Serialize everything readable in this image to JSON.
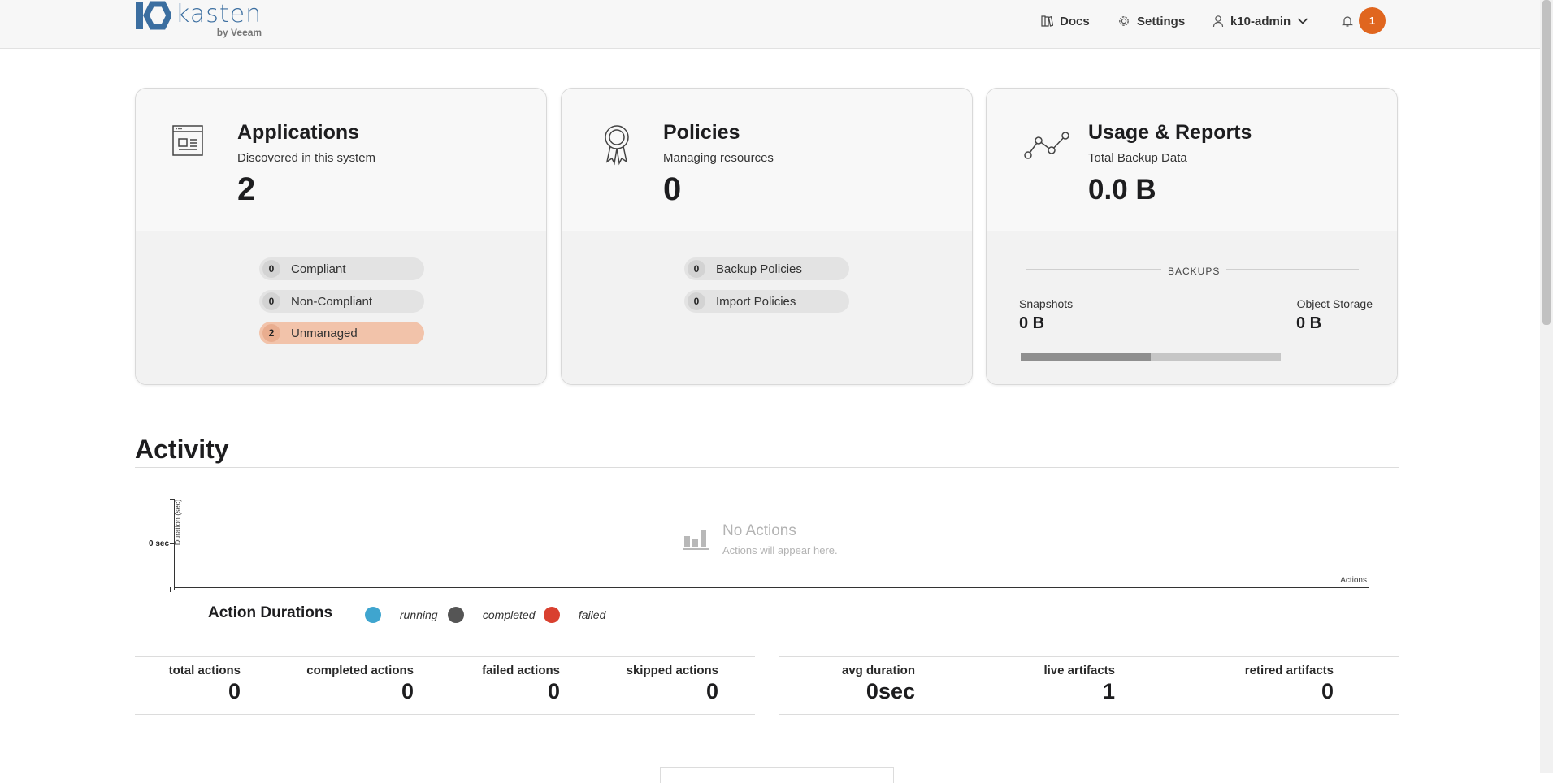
{
  "header": {
    "logo_word": "kasten",
    "logo_sub": "by Veeam",
    "docs_label": "Docs",
    "settings_label": "Settings",
    "user_label": "k10-admin",
    "notification_count": "1",
    "accent_color": "#e0661f"
  },
  "cards": {
    "applications": {
      "title": "Applications",
      "subtitle": "Discovered in this system",
      "count": "2",
      "compliant_count": "0",
      "compliant_label": "Compliant",
      "noncompliant_count": "0",
      "noncompliant_label": "Non-Compliant",
      "unmanaged_count": "2",
      "unmanaged_label": "Unmanaged"
    },
    "policies": {
      "title": "Policies",
      "subtitle": "Managing resources",
      "count": "0",
      "backup_count": "0",
      "backup_label": "Backup Policies",
      "import_count": "0",
      "import_label": "Import Policies"
    },
    "usage": {
      "title": "Usage & Reports",
      "subtitle": "Total Backup Data",
      "total": "0.0 B",
      "backups_label": "BACKUPS",
      "snapshots_label": "Snapshots",
      "snapshots_value": "0 B",
      "object_storage_label": "Object Storage",
      "object_storage_value": "0 B"
    }
  },
  "activity": {
    "title": "Activity",
    "chart": {
      "y_tick": "0 sec",
      "y_label": "Duration (sec)",
      "x_label": "Actions",
      "empty_title": "No Actions",
      "empty_sub": "Actions will appear here."
    },
    "legend": {
      "title": "Action Durations",
      "running": "— running",
      "completed": "— completed",
      "failed": "— failed",
      "running_color": "#3fa5cf",
      "completed_color": "#555555",
      "failed_color": "#d9402f"
    },
    "stats": {
      "total_label": "total actions",
      "total_value": "0",
      "completed_label": "completed actions",
      "completed_value": "0",
      "failed_label": "failed actions",
      "failed_value": "0",
      "skipped_label": "skipped actions",
      "skipped_value": "0",
      "avg_label": "avg duration",
      "avg_value": "0sec",
      "live_label": "live artifacts",
      "live_value": "1",
      "retired_label": "retired artifacts",
      "retired_value": "0"
    }
  }
}
